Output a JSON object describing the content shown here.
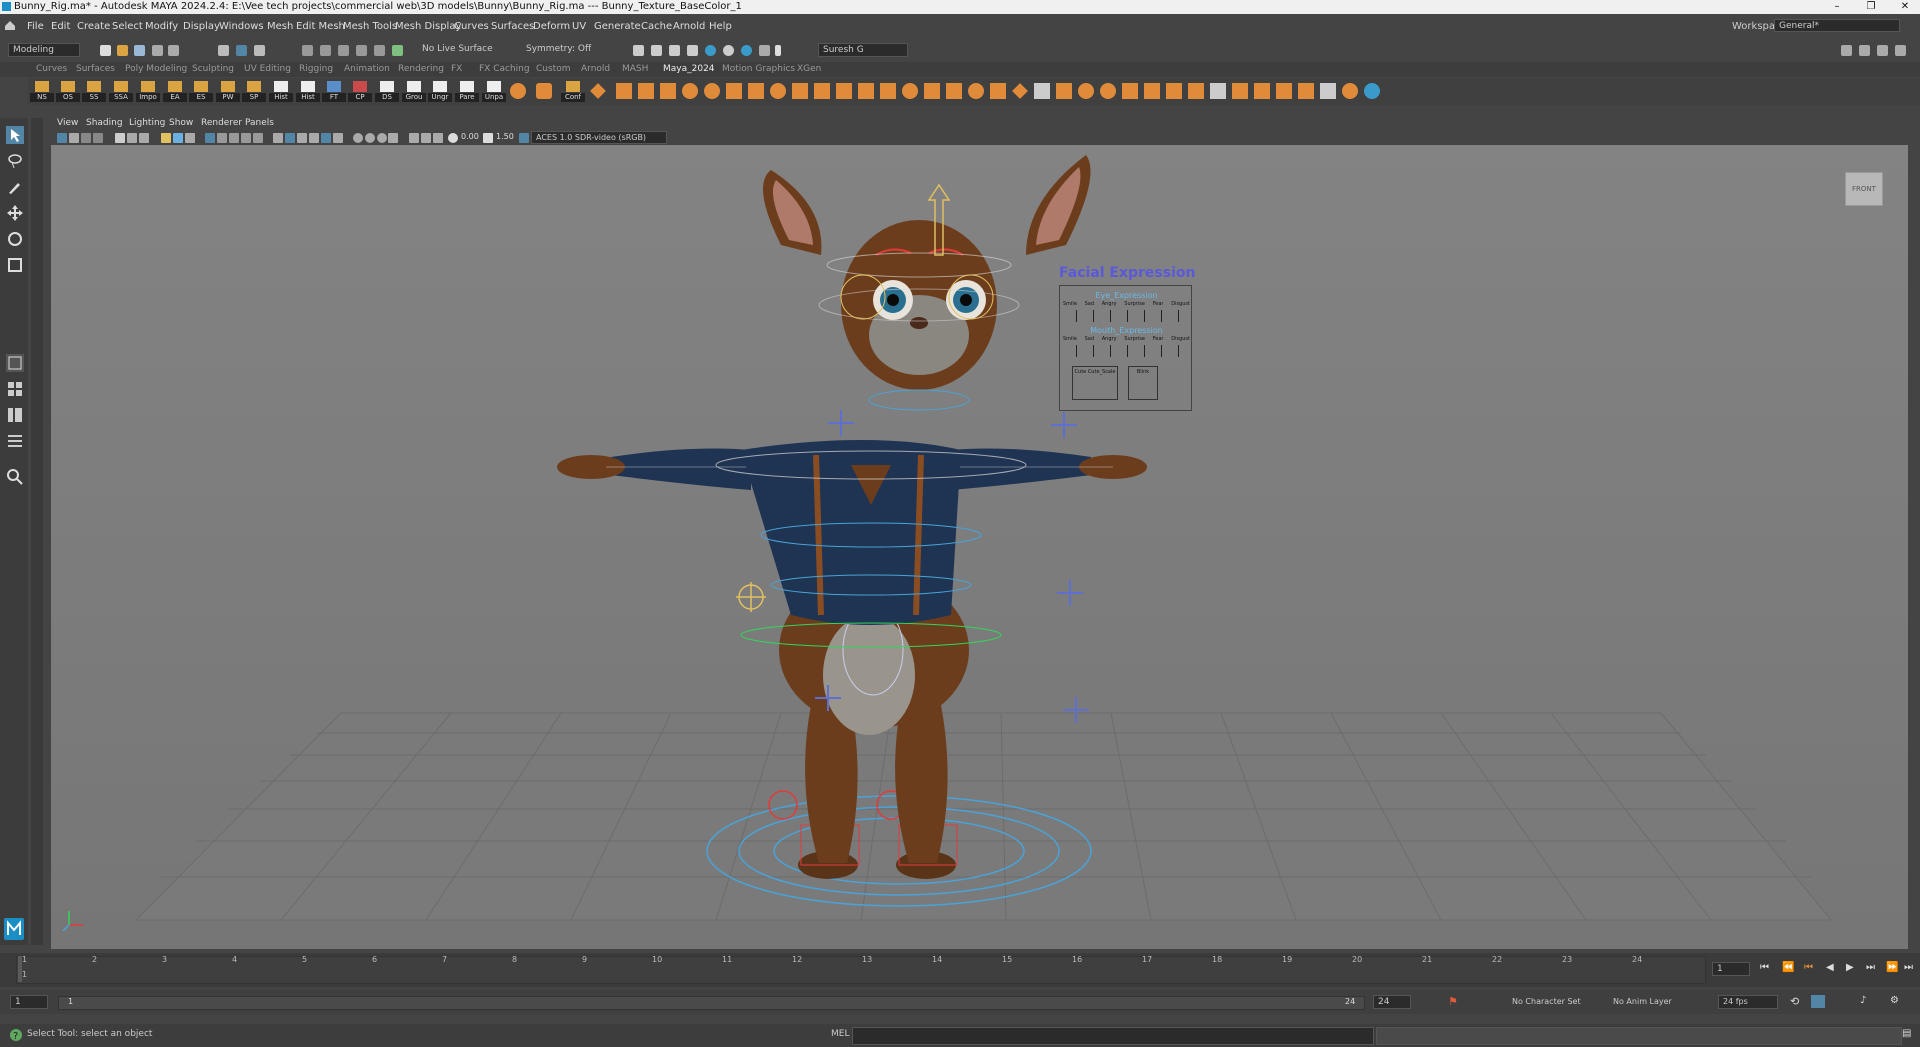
{
  "titlebar": {
    "title": "Bunny_Rig.ma* - Autodesk MAYA 2024.2.4: E:\\Vee tech projects\\commercial web\\3D models\\Bunny\\Bunny_Rig.ma  ---  Bunny_Texture_BaseColor_1",
    "minimize": "–",
    "maximize": "❐",
    "close": "✕"
  },
  "menubar": {
    "items": [
      "File",
      "Edit",
      "Create",
      "Select",
      "Modify",
      "Display",
      "Windows",
      "Mesh",
      "Edit Mesh",
      "Mesh Tools",
      "Mesh Display",
      "Curves",
      "Surfaces",
      "Deform",
      "UV",
      "Generate",
      "Cache",
      "Arnold",
      "Help"
    ],
    "workspace_label": "Workspace:",
    "workspace_value": "General*"
  },
  "statusline": {
    "menu_set": "Modeling",
    "live_surface": "No Live Surface",
    "symmetry": "Symmetry: Off",
    "user": "Suresh G"
  },
  "shelf_tabs": {
    "items": [
      "Curves",
      "Surfaces",
      "Poly Modeling",
      "Sculpting",
      "UV Editing",
      "Rigging",
      "Animation",
      "Rendering",
      "FX",
      "FX Caching",
      "Custom",
      "Arnold",
      "MASH",
      "Maya_2024",
      "Motion Graphics",
      "XGen"
    ],
    "active": "Maya_2024"
  },
  "shelf_buttons": [
    "NS",
    "OS",
    "SS",
    "SSA",
    "Impo",
    "EA",
    "ES",
    "PW",
    "SP",
    "Hist",
    "Hist",
    "FT",
    "CP",
    "DS",
    "Grou",
    "Ungr",
    "Pare",
    "Unpa",
    "Conf"
  ],
  "panel_menu": [
    "View",
    "Shading",
    "Lighting",
    "Show",
    "Renderer",
    "Panels"
  ],
  "panel_toolbar": {
    "exposure": "0.00",
    "gamma": "1.50",
    "color_space": "ACES 1.0 SDR-video (sRGB)"
  },
  "viewport": {
    "view_cube": "FRONT",
    "facial_panel": {
      "title": "Facial Expression",
      "eye_title": "Eye_Expression",
      "mouth_title": "Mouth_Expression",
      "labels": [
        "Smile",
        "Sad",
        "Angry",
        "Surprise",
        "Fear",
        "Disgust"
      ],
      "cute_label": "Cute Cute_Scale",
      "blink_label": "Blink"
    }
  },
  "timeline": {
    "ticks": [
      "1",
      "2",
      "3",
      "4",
      "5",
      "6",
      "7",
      "8",
      "9",
      "10",
      "11",
      "12",
      "13",
      "14",
      "15",
      "16",
      "17",
      "18",
      "19",
      "20",
      "21",
      "22",
      "23",
      "24"
    ],
    "current_frame": "1",
    "frame_field": "1"
  },
  "range": {
    "start": "1",
    "slider_start": "1",
    "slider_end": "24",
    "end": "24",
    "character_set": "No Character Set",
    "anim_layer": "No Anim Layer",
    "fps": "24 fps"
  },
  "cmdline": {
    "help": "Select Tool: select an object",
    "mel": "MEL"
  },
  "colors": {
    "accent": "#5285a6",
    "shelf_orange": "#e08b3a",
    "viewport_bg": "#7d7d7d",
    "grid": "#6e6e6e"
  }
}
